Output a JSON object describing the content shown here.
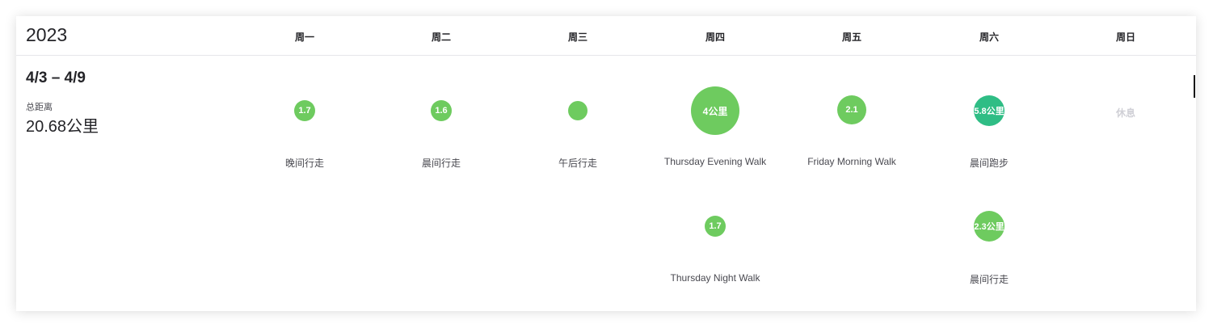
{
  "year": "2023",
  "days": [
    "周一",
    "周二",
    "周三",
    "周四",
    "周五",
    "周六",
    "周日"
  ],
  "week": {
    "range": "4/3 – 4/9",
    "distance_label": "总距离",
    "distance_value": "20.68公里"
  },
  "activities": [
    {
      "day": "周一",
      "bubble": "1.7",
      "name": "晚间行走",
      "type": "walk"
    },
    {
      "day": "周二",
      "bubble": "1.6",
      "name": "晨间行走",
      "type": "walk"
    },
    {
      "day": "周三",
      "bubble": "",
      "name": "午后行走",
      "type": "walk"
    },
    {
      "day": "周四",
      "bubble": "4公里",
      "name": "Thursday Evening Walk",
      "type": "walk"
    },
    {
      "day": "周五",
      "bubble": "2.1",
      "name": "Friday Morning Walk",
      "type": "walk"
    },
    {
      "day": "周六",
      "bubble": "5.8公里",
      "name": "晨间跑步",
      "type": "run"
    },
    {
      "day": "周四",
      "bubble": "1.7",
      "name": "Thursday Night Walk",
      "type": "walk"
    },
    {
      "day": "周六",
      "bubble": "2.3公里",
      "name": "晨间行走",
      "type": "walk"
    }
  ],
  "rest_label": "休息",
  "colors": {
    "walk": "#6ecb5f",
    "run": "#2fbd85",
    "rest": "#d0d0d6"
  }
}
